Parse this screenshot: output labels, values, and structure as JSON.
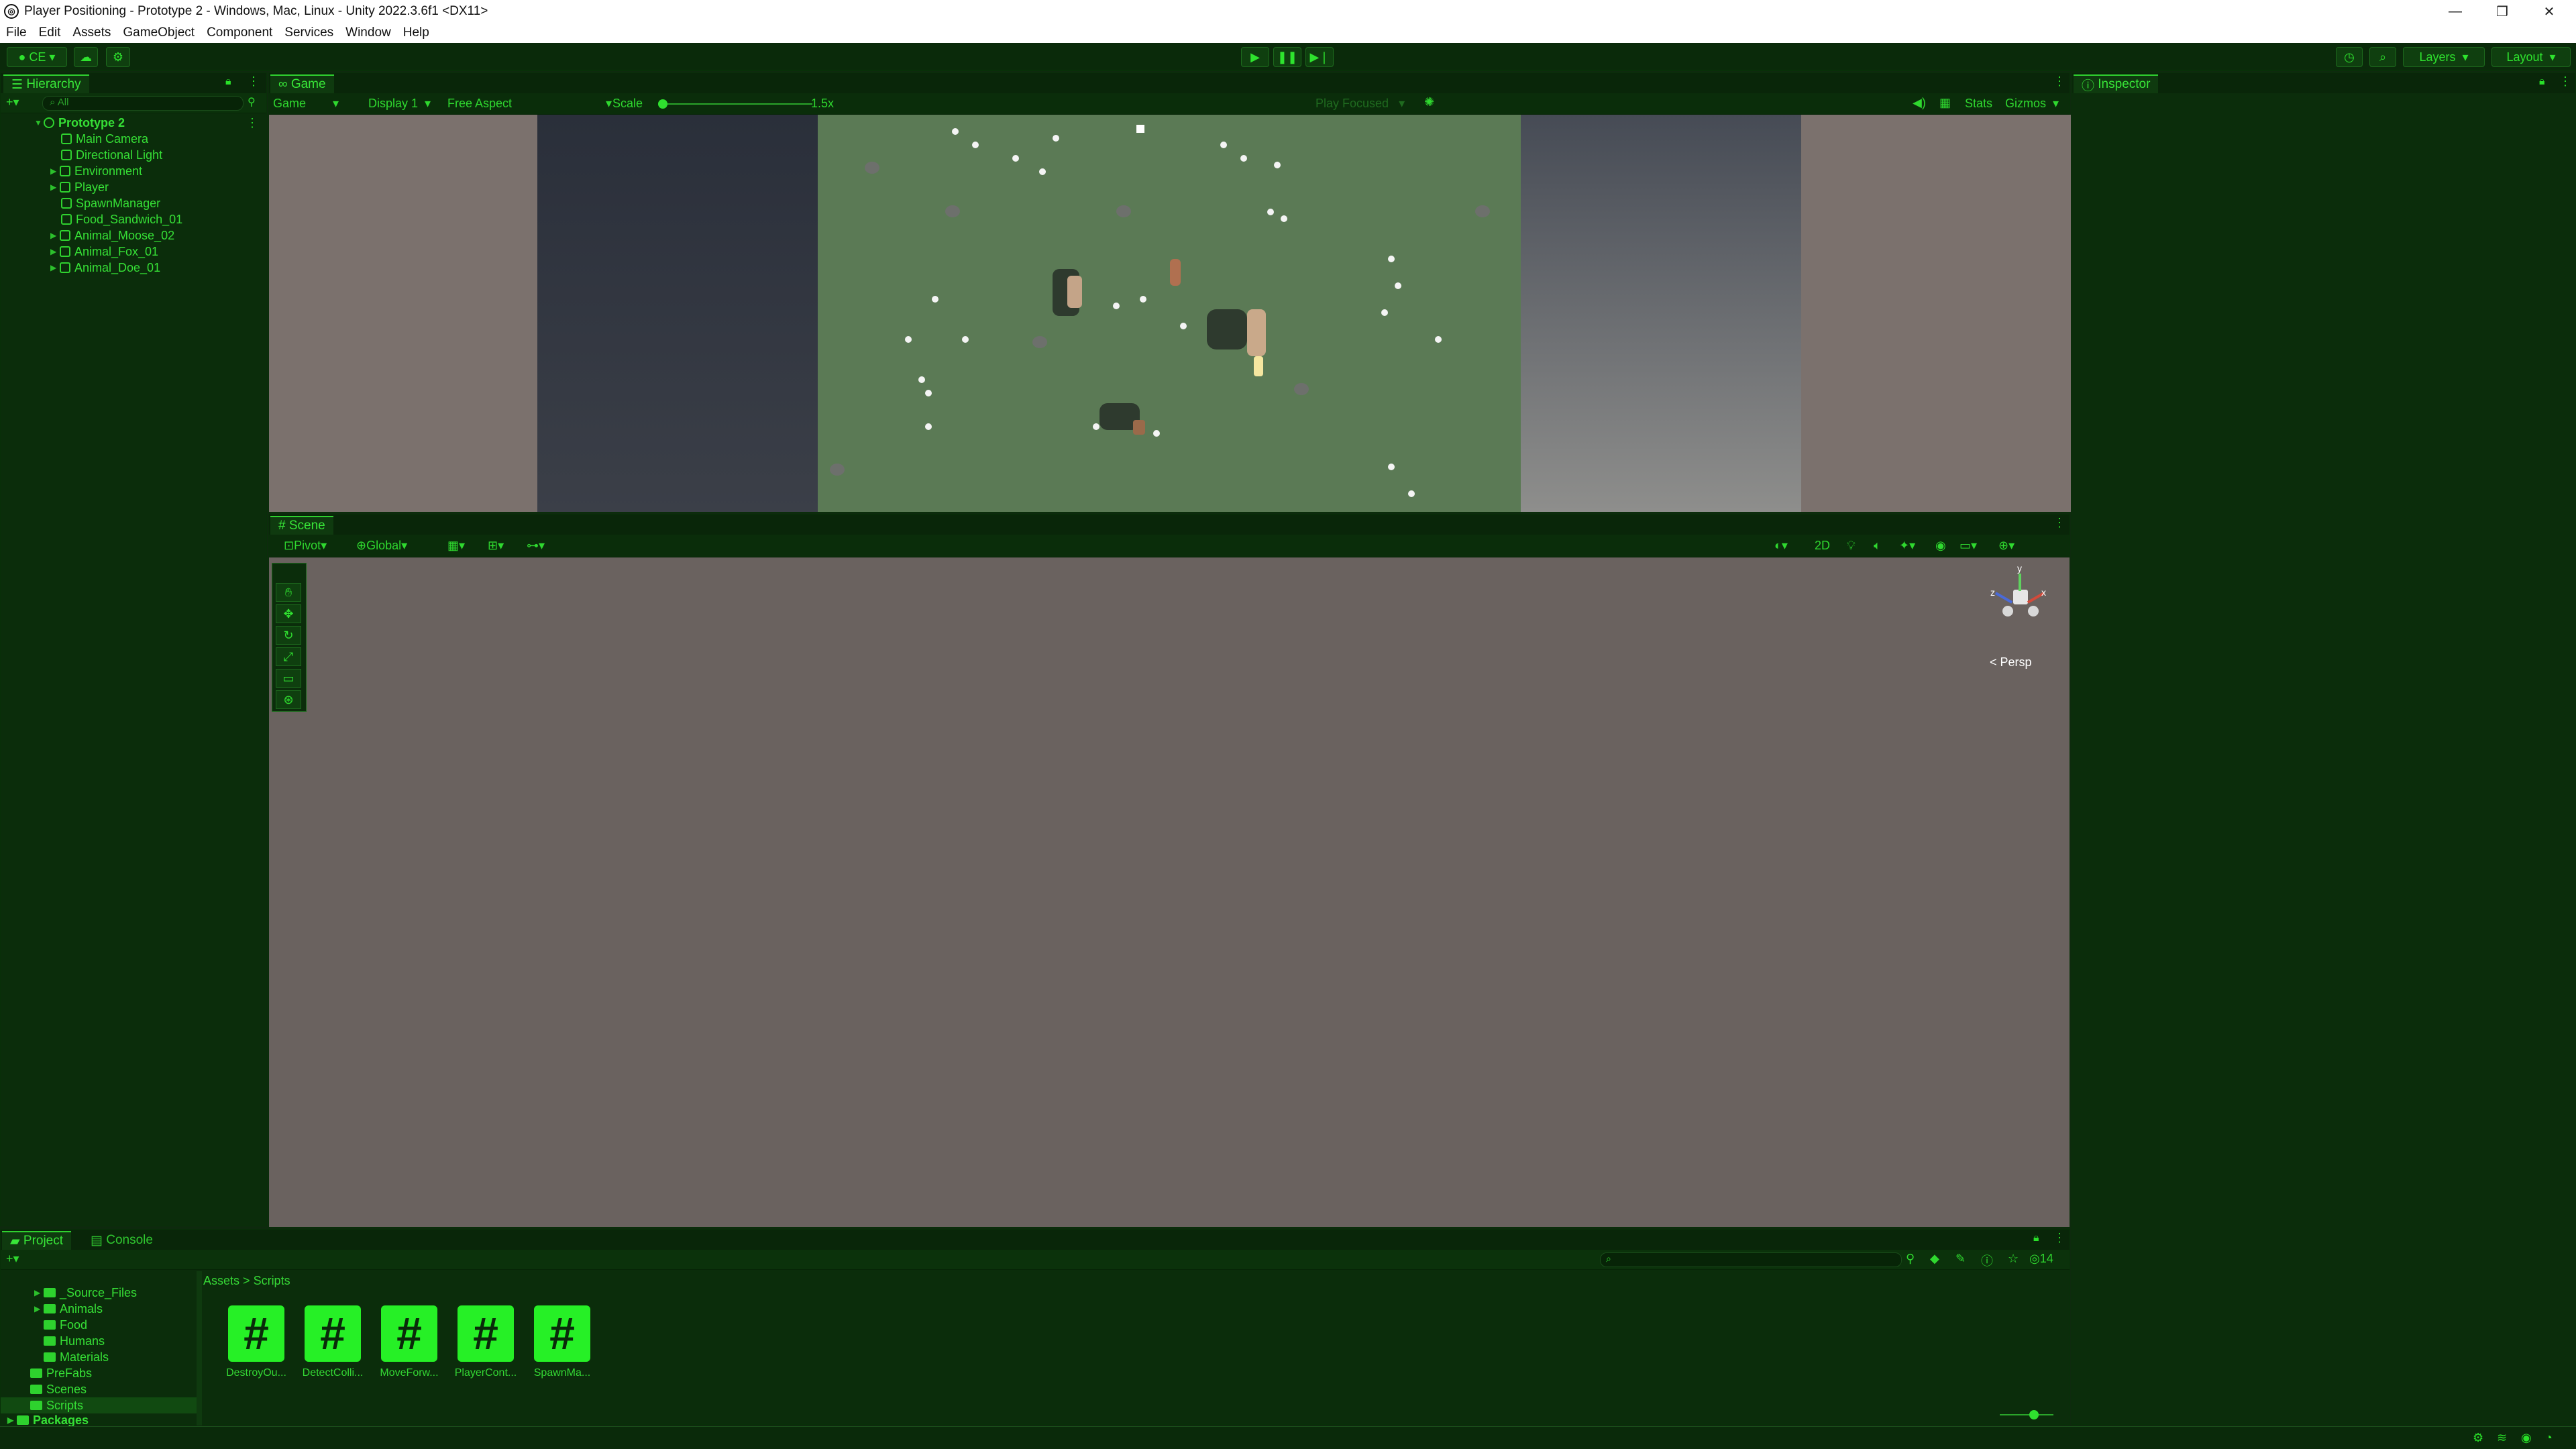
{
  "window": {
    "title": "Player Positioning - Prototype 2 - Windows, Mac, Linux - Unity 2022.3.6f1 <DX11>",
    "min_icon": "minimize-icon",
    "max_icon": "restore-icon",
    "close_icon": "close-icon"
  },
  "menu": [
    "File",
    "Edit",
    "Assets",
    "GameObject",
    "Component",
    "Services",
    "Window",
    "Help"
  ],
  "toolbar": {
    "account_label": "CE",
    "layers_label": "Layers",
    "layout_label": "Layout"
  },
  "hierarchy": {
    "tab_label": "Hierarchy",
    "search_placeholder": "All",
    "scene_name": "Prototype 2",
    "items": [
      "Main Camera",
      "Directional Light",
      "Environment",
      "Player",
      "SpawnManager",
      "Food_Sandwich_01",
      "Animal_Moose_02",
      "Animal_Fox_01",
      "Animal_Doe_01"
    ]
  },
  "game": {
    "tab_label": "Game",
    "view_dropdown": "Game",
    "display_dropdown": "Display 1",
    "aspect_dropdown": "Free Aspect",
    "scale_label": "Scale",
    "scale_value": "1.5x",
    "play_mode": "Play Focused",
    "stats_label": "Stats",
    "gizmos_label": "Gizmos"
  },
  "scene": {
    "tab_label": "Scene",
    "pivot_label": "Pivot",
    "global_label": "Global",
    "mode_2d": "2D",
    "persp_label": "< Persp",
    "axis_y": "y",
    "axis_z": "z",
    "axis_x": "x"
  },
  "inspector": {
    "tab_label": "Inspector"
  },
  "project": {
    "tab_label": "Project",
    "console_tab_label": "Console",
    "breadcrumb": [
      "Assets",
      "Scripts"
    ],
    "badge_count": "14",
    "folders": [
      "_Source_Files",
      "Animals",
      "Food",
      "Humans",
      "Materials",
      "PreFabs",
      "Scenes",
      "Scripts",
      "Packages"
    ],
    "scripts": [
      "DestroyOu...",
      "DetectColli...",
      "MoveForw...",
      "PlayerCont...",
      "SpawnMa..."
    ]
  },
  "colors": {
    "accent": "#2fe02f",
    "panel_bg": "#0b2d0b",
    "scene_bg": "#6a625f",
    "grass": "#5a7a54"
  }
}
